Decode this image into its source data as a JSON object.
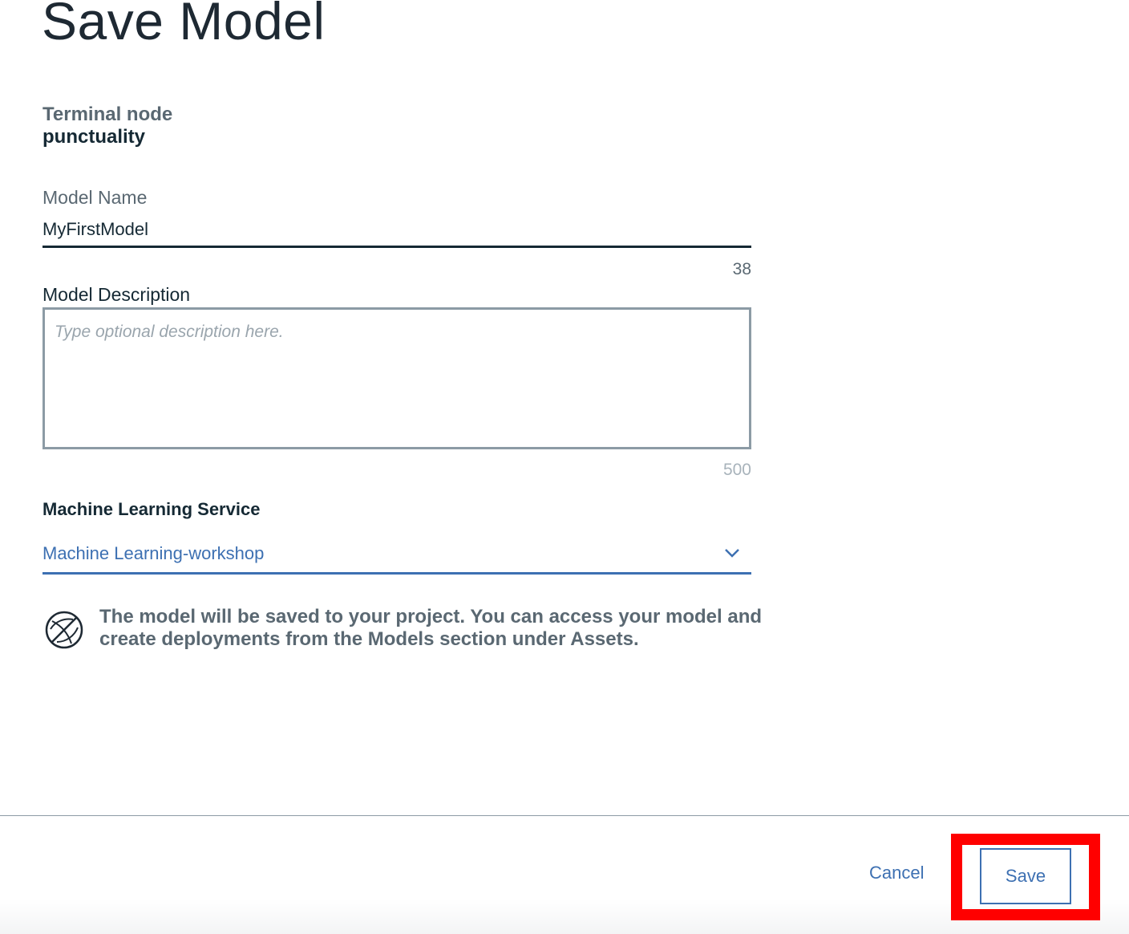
{
  "page_title": "Save Model",
  "terminal_node": {
    "label": "Terminal node",
    "value": "punctuality"
  },
  "model_name": {
    "label": "Model Name",
    "value": "MyFirstModel",
    "remaining_chars": "38"
  },
  "model_description": {
    "label": "Model Description",
    "placeholder": "Type optional description here.",
    "value": "",
    "remaining_chars": "500"
  },
  "ml_service": {
    "label": "Machine Learning Service",
    "selected": "Machine Learning-workshop"
  },
  "info": {
    "icon": "globe-icon",
    "text": "The model will be saved to your project. You can access your model and create deployments from the Models section under Assets."
  },
  "footer": {
    "cancel_label": "Cancel",
    "save_label": "Save"
  },
  "colors": {
    "accent": "#3d70b2",
    "text_primary": "#152934",
    "text_secondary": "#5a6872",
    "highlight": "#ff0000"
  }
}
